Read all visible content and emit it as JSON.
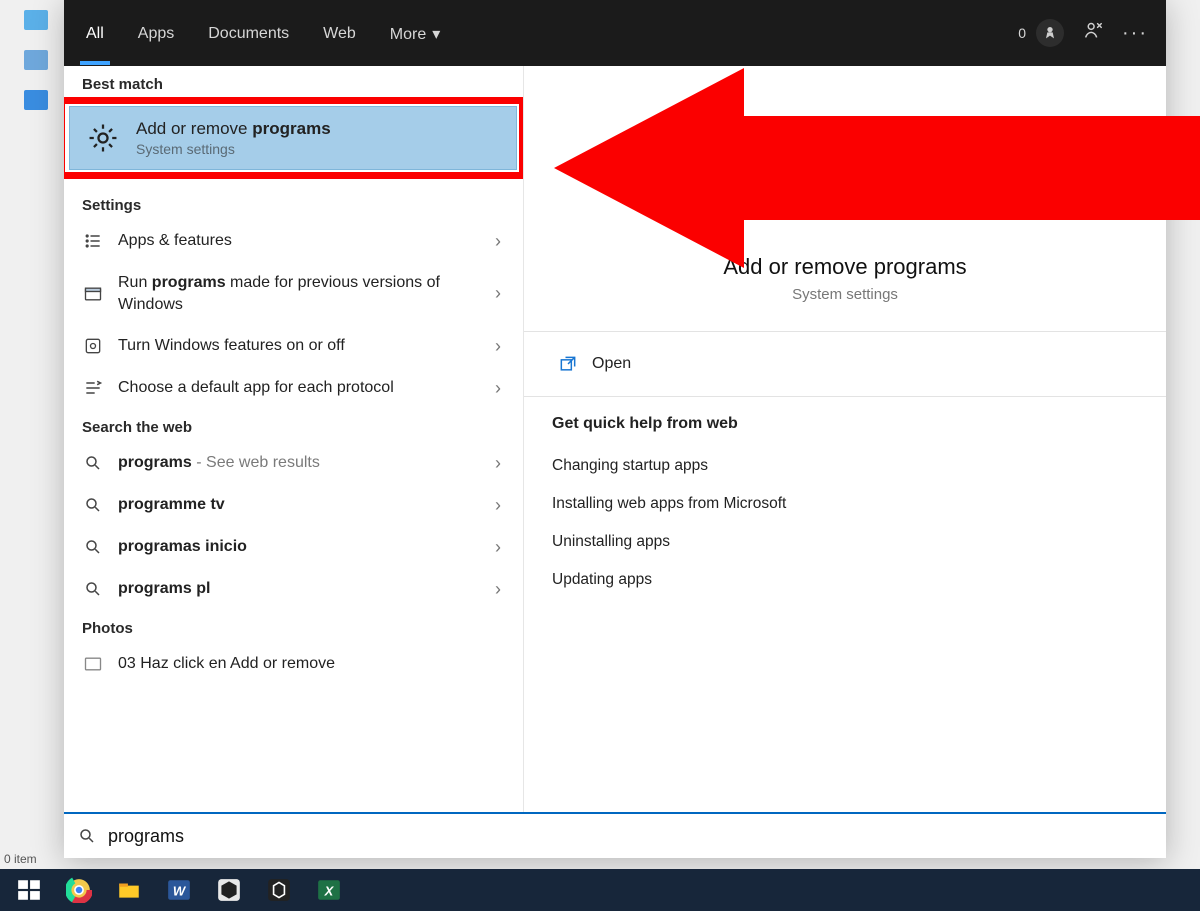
{
  "tabs": {
    "all": "All",
    "apps": "Apps",
    "documents": "Documents",
    "web": "Web",
    "more": "More"
  },
  "topright": {
    "points": "0"
  },
  "sections": {
    "best_match": "Best match",
    "settings": "Settings",
    "search_web": "Search the web",
    "photos": "Photos"
  },
  "best_match": {
    "title_pre": "Add or remove ",
    "title_bold": "programs",
    "subtitle": "System settings"
  },
  "settings_items": [
    {
      "label": "Apps & features"
    },
    {
      "label_pre": "Run ",
      "label_bold": "programs",
      "label_post": " made for previous versions of Windows"
    },
    {
      "label": "Turn Windows features on or off"
    },
    {
      "label": "Choose a default app for each protocol"
    }
  ],
  "web_items": [
    {
      "bold": "programs",
      "suffix": " - See web results"
    },
    {
      "bold": "programme tv"
    },
    {
      "bold": "programas inicio"
    },
    {
      "bold": "programs pl"
    }
  ],
  "photos_items": [
    {
      "label": "03 Haz click en Add or remove"
    }
  ],
  "right": {
    "title": "Add or remove programs",
    "subtitle": "System settings",
    "open": "Open",
    "help_header": "Get quick help from web",
    "links": [
      "Changing startup apps",
      "Installing web apps from Microsoft",
      "Uninstalling apps",
      "Updating apps"
    ]
  },
  "search": {
    "value": "programs"
  },
  "statusbar": "0 item"
}
